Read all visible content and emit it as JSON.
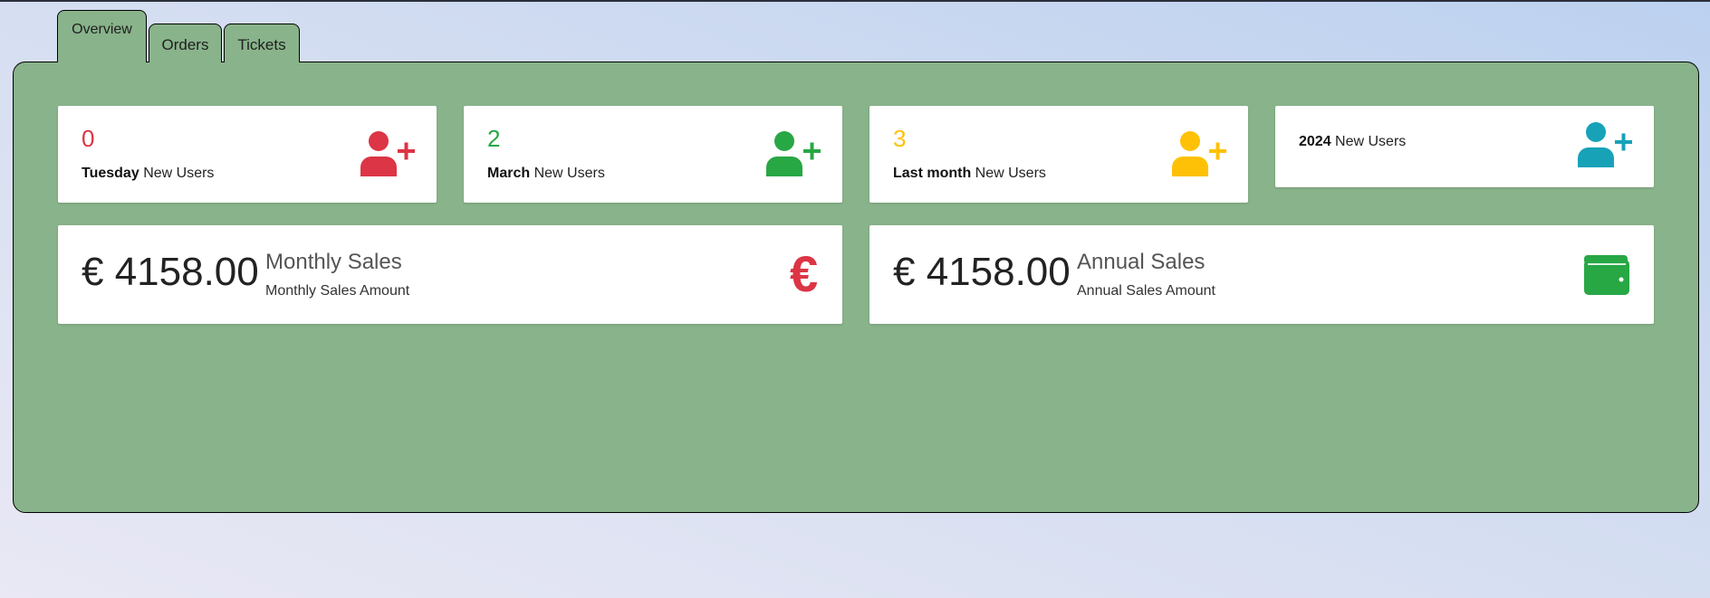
{
  "tabs": [
    {
      "label": "Overview",
      "active": true
    },
    {
      "label": "Orders",
      "active": false
    },
    {
      "label": "Tickets",
      "active": false
    }
  ],
  "user_cards": [
    {
      "value": "0",
      "period": "Tuesday",
      "suffix": "New Users",
      "color": "#dc3545",
      "icon": "user-plus-icon"
    },
    {
      "value": "2",
      "period": "March",
      "suffix": "New Users",
      "color": "#28a745",
      "icon": "user-plus-icon"
    },
    {
      "value": "3",
      "period": "Last month",
      "suffix": "New Users",
      "color": "#ffc107",
      "icon": "user-plus-icon"
    },
    {
      "value": "",
      "period": "2024",
      "suffix": "New Users",
      "color": "#17a2b8",
      "icon": "user-plus-icon"
    }
  ],
  "sales_cards": [
    {
      "amount": "€ 4158.00",
      "title": "Monthly Sales",
      "subtitle": "Monthly Sales Amount",
      "icon": "euro-icon",
      "icon_color": "#dc3545",
      "icon_glyph": "€"
    },
    {
      "amount": "€ 4158.00",
      "title": "Annual Sales",
      "subtitle": "Annual Sales Amount",
      "icon": "wallet-icon",
      "icon_color": "#28a745"
    }
  ],
  "colors": {
    "panel": "#89b38b",
    "card": "#ffffff"
  }
}
